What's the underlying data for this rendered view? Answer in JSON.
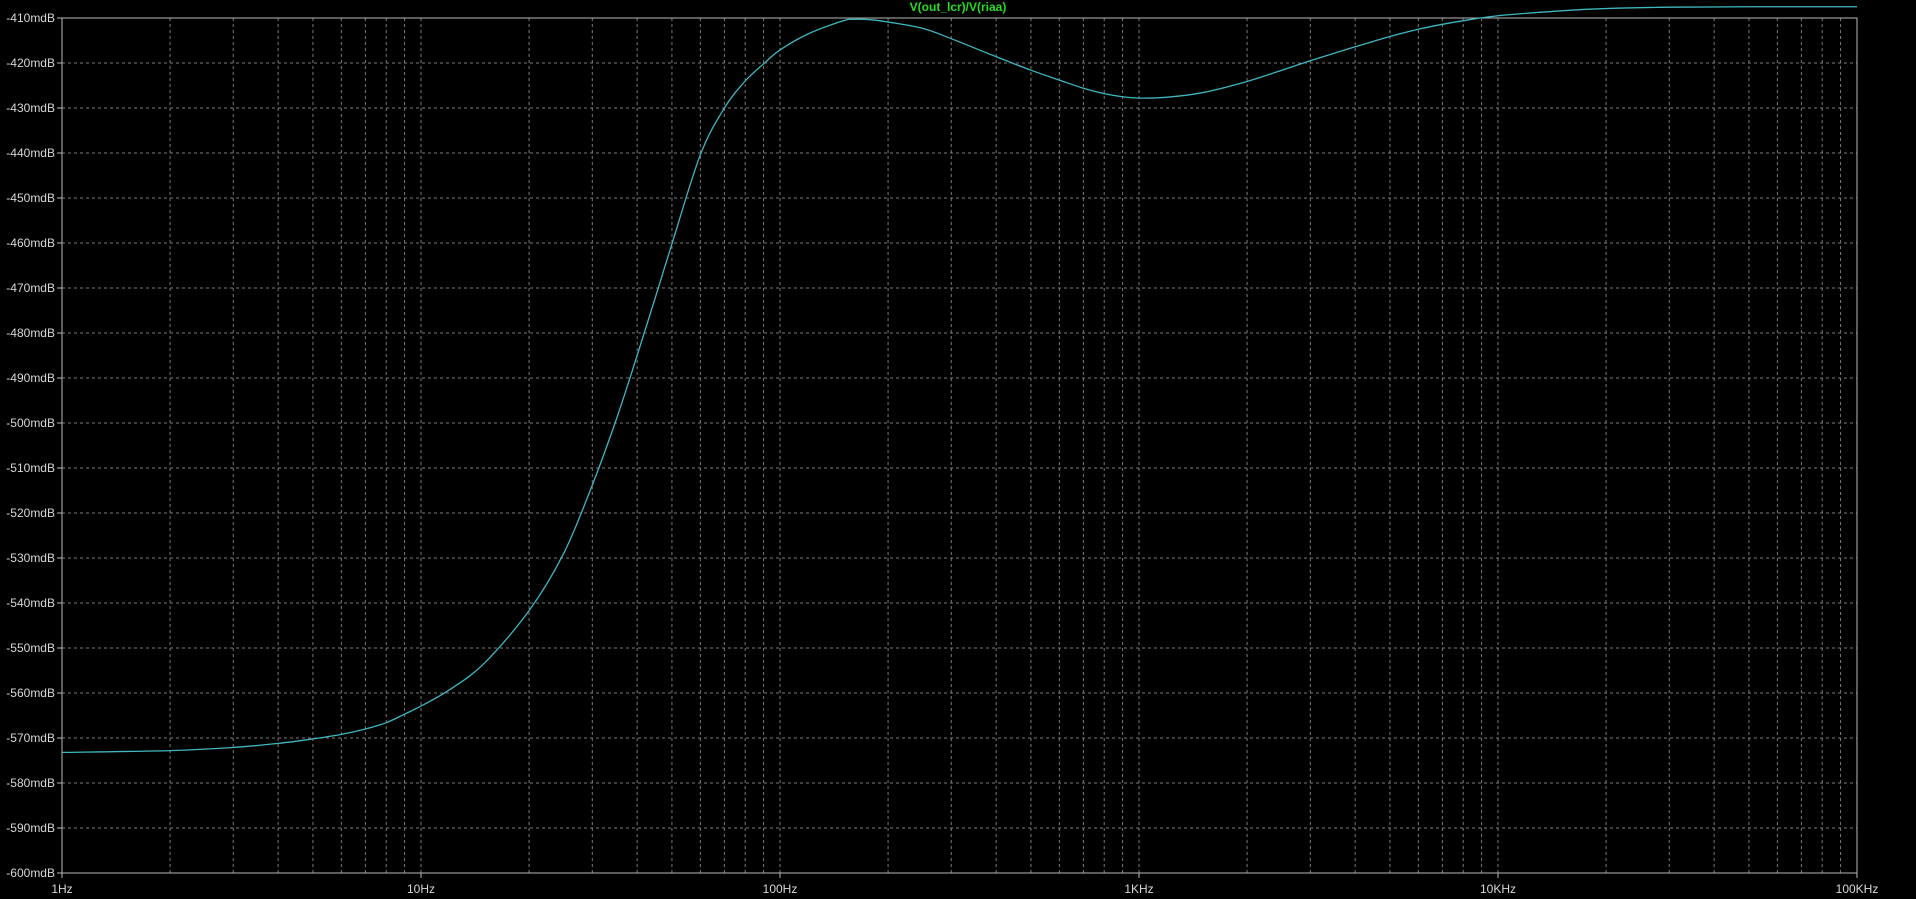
{
  "chart_data": {
    "type": "line",
    "title": "V(out_lcr)/V(riaa)",
    "xscale": "log",
    "x_ticks": [
      {
        "value": 1,
        "label": "1Hz"
      },
      {
        "value": 10,
        "label": "10Hz"
      },
      {
        "value": 100,
        "label": "100Hz"
      },
      {
        "value": 1000,
        "label": "1KHz"
      },
      {
        "value": 10000,
        "label": "10KHz"
      },
      {
        "value": 100000,
        "label": "100KHz"
      }
    ],
    "xlim": [
      1,
      100000
    ],
    "ylim": [
      -600,
      -410
    ],
    "y_ticks": [
      {
        "value": -410,
        "label": "-410mdB"
      },
      {
        "value": -420,
        "label": "-420mdB"
      },
      {
        "value": -430,
        "label": "-430mdB"
      },
      {
        "value": -440,
        "label": "-440mdB"
      },
      {
        "value": -450,
        "label": "-450mdB"
      },
      {
        "value": -460,
        "label": "-460mdB"
      },
      {
        "value": -470,
        "label": "-470mdB"
      },
      {
        "value": -480,
        "label": "-480mdB"
      },
      {
        "value": -490,
        "label": "-490mdB"
      },
      {
        "value": -500,
        "label": "-500mdB"
      },
      {
        "value": -510,
        "label": "-510mdB"
      },
      {
        "value": -520,
        "label": "-520mdB"
      },
      {
        "value": -530,
        "label": "-530mdB"
      },
      {
        "value": -540,
        "label": "-540mdB"
      },
      {
        "value": -550,
        "label": "-550mdB"
      },
      {
        "value": -560,
        "label": "-560mdB"
      },
      {
        "value": -570,
        "label": "-570mdB"
      },
      {
        "value": -580,
        "label": "-580mdB"
      },
      {
        "value": -590,
        "label": "-590mdB"
      },
      {
        "value": -600,
        "label": "-600mdB"
      }
    ],
    "grid": true,
    "series": [
      {
        "color": "#3fb6c0",
        "points": [
          [
            1,
            -573.2
          ],
          [
            2,
            -572.8
          ],
          [
            3,
            -572.1
          ],
          [
            4,
            -571.2
          ],
          [
            5,
            -570.2
          ],
          [
            6,
            -569.2
          ],
          [
            7,
            -568.0
          ],
          [
            8,
            -566.6
          ],
          [
            9,
            -564.7
          ],
          [
            10,
            -562.9
          ],
          [
            12,
            -559.3
          ],
          [
            15,
            -553.4
          ],
          [
            20,
            -541.7
          ],
          [
            25,
            -528.9
          ],
          [
            30,
            -513.8
          ],
          [
            35,
            -499.2
          ],
          [
            40,
            -485.0
          ],
          [
            45,
            -472.0
          ],
          [
            50,
            -460.2
          ],
          [
            60,
            -440.4
          ],
          [
            70,
            -430.0
          ],
          [
            80,
            -424.0
          ],
          [
            90,
            -420.2
          ],
          [
            100,
            -417.1
          ],
          [
            120,
            -413.5
          ],
          [
            150,
            -410.6
          ],
          [
            160,
            -410.3
          ],
          [
            180,
            -410.4
          ],
          [
            200,
            -410.9
          ],
          [
            250,
            -412.3
          ],
          [
            300,
            -414.6
          ],
          [
            400,
            -418.6
          ],
          [
            500,
            -421.6
          ],
          [
            600,
            -423.8
          ],
          [
            700,
            -425.6
          ],
          [
            800,
            -426.8
          ],
          [
            900,
            -427.5
          ],
          [
            1000,
            -427.8
          ],
          [
            1200,
            -427.6
          ],
          [
            1500,
            -426.6
          ],
          [
            2000,
            -424.1
          ],
          [
            2500,
            -421.6
          ],
          [
            3000,
            -419.5
          ],
          [
            4000,
            -416.4
          ],
          [
            5000,
            -414.1
          ],
          [
            6000,
            -412.5
          ],
          [
            7000,
            -411.4
          ],
          [
            8000,
            -410.6
          ],
          [
            10000,
            -409.5
          ],
          [
            15000,
            -408.4
          ],
          [
            20000,
            -407.9
          ],
          [
            30000,
            -407.6
          ],
          [
            50000,
            -407.5
          ],
          [
            100000,
            -407.5
          ]
        ]
      }
    ]
  }
}
